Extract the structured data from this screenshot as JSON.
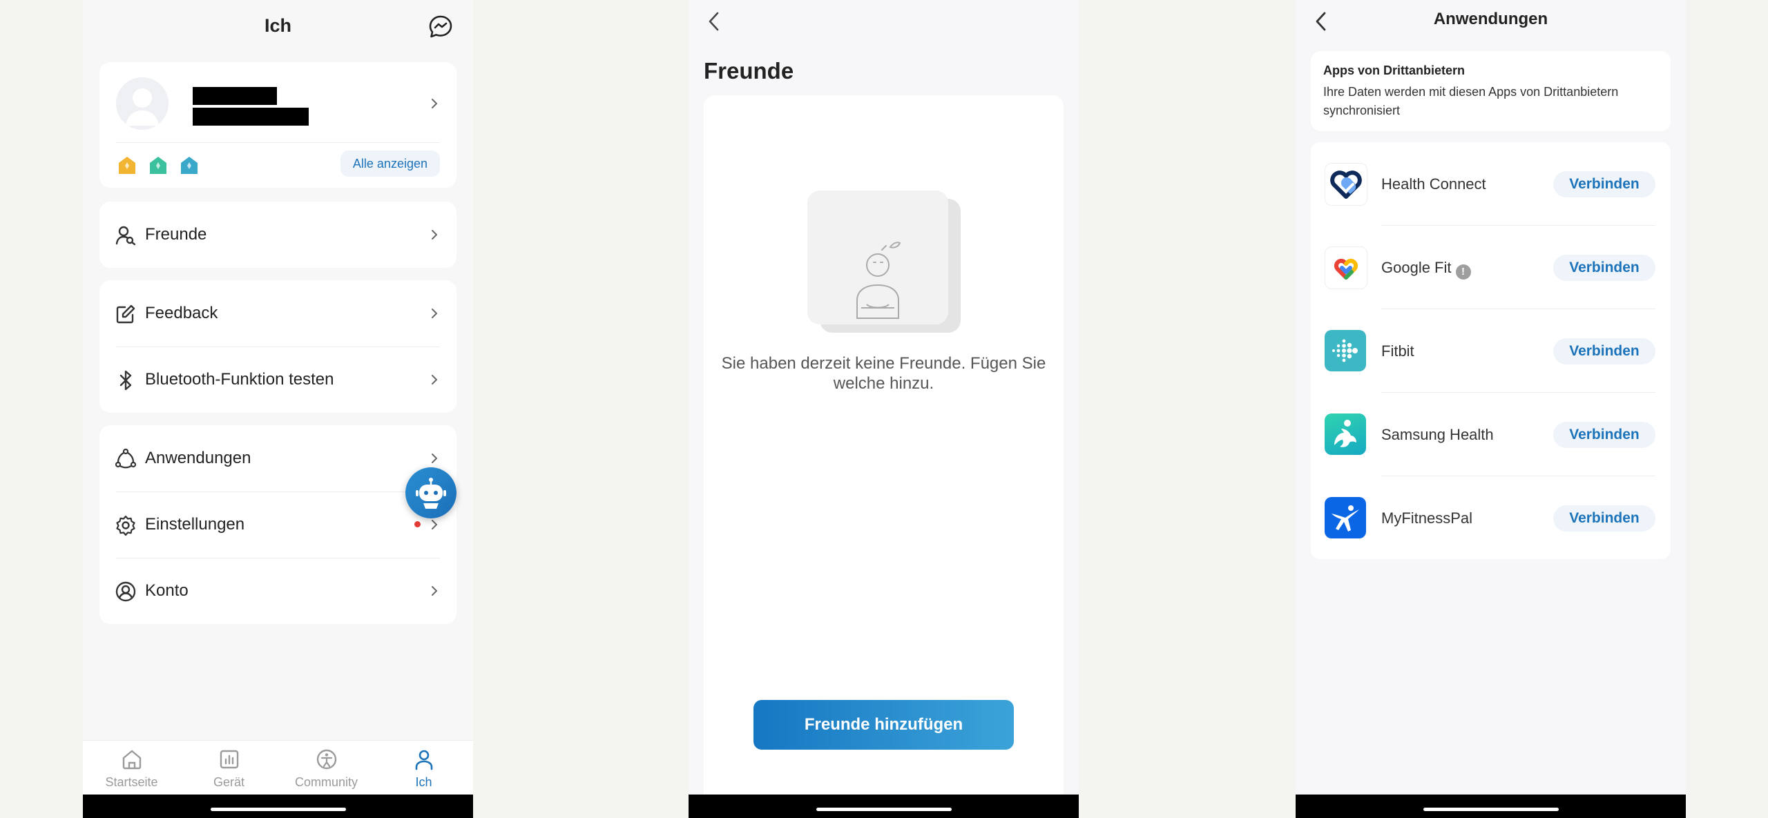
{
  "me_screen": {
    "title": "Ich",
    "show_all_label": "Alle anzeigen",
    "menu": {
      "friends": "Freunde",
      "feedback": "Feedback",
      "bluetooth_test": "Bluetooth-Funktion testen",
      "apps": "Anwendungen",
      "settings": "Einstellungen",
      "account": "Konto"
    },
    "tabs": {
      "home": "Startseite",
      "device": "Gerät",
      "community": "Community",
      "me": "Ich"
    },
    "accent_color": "#1c73b9",
    "badge_colors": [
      "#f2b531",
      "#3cc19e",
      "#3aa8c9"
    ]
  },
  "friends_screen": {
    "title": "Freunde",
    "empty_message": "Sie haben derzeit keine Freunde. Fügen Sie welche hinzu.",
    "add_button": "Freunde hinzufügen"
  },
  "apps_screen": {
    "title": "Anwendungen",
    "info_title": "Apps von Drittanbietern",
    "info_description": "Ihre Daten werden mit diesen Apps von Drittanbietern synchronisiert",
    "connect_label": "Verbinden",
    "apps": [
      {
        "name": "Health Connect",
        "icon": "health-connect-logo"
      },
      {
        "name": "Google Fit",
        "icon": "google-fit-logo",
        "has_info": true
      },
      {
        "name": "Fitbit",
        "icon": "fitbit-logo"
      },
      {
        "name": "Samsung Health",
        "icon": "samsung-health-logo"
      },
      {
        "name": "MyFitnessPal",
        "icon": "myfitnesspal-logo"
      }
    ]
  }
}
